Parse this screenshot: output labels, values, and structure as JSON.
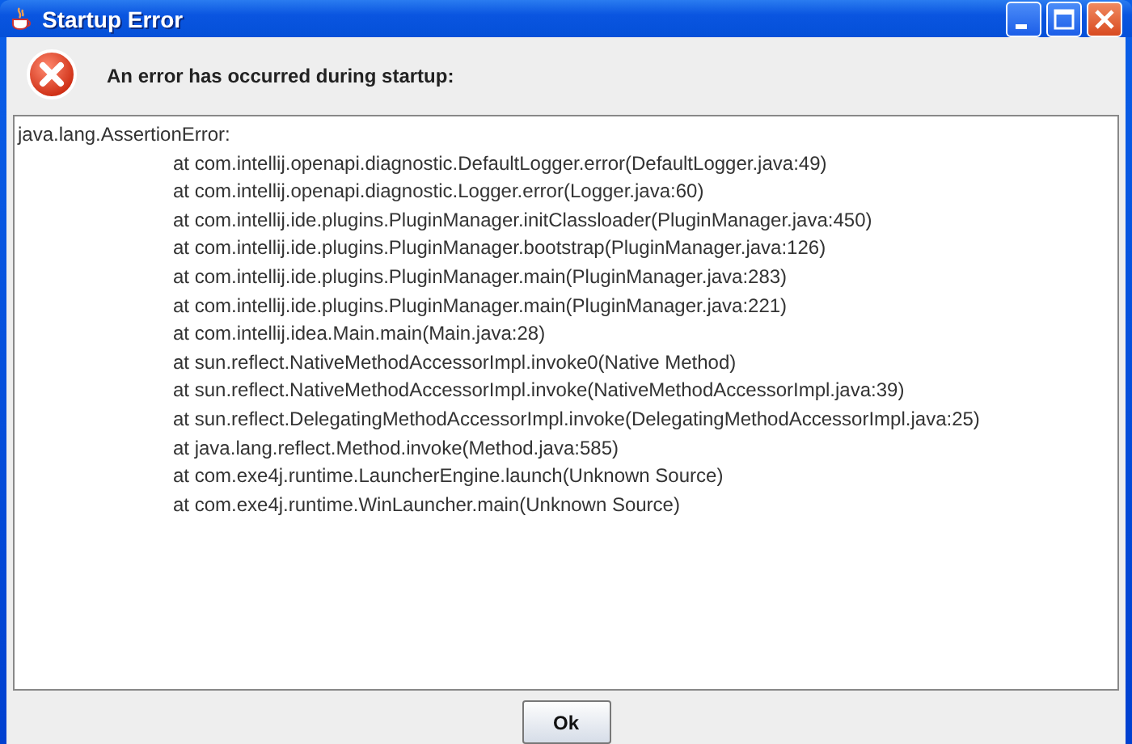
{
  "window": {
    "title": "Startup Error"
  },
  "message": "An error has occurred during startup:",
  "error": {
    "heading": "java.lang.AssertionError:",
    "stack": [
      "at com.intellij.openapi.diagnostic.DefaultLogger.error(DefaultLogger.java:49)",
      "at com.intellij.openapi.diagnostic.Logger.error(Logger.java:60)",
      "at com.intellij.ide.plugins.PluginManager.initClassloader(PluginManager.java:450)",
      "at com.intellij.ide.plugins.PluginManager.bootstrap(PluginManager.java:126)",
      "at com.intellij.ide.plugins.PluginManager.main(PluginManager.java:283)",
      "at com.intellij.ide.plugins.PluginManager.main(PluginManager.java:221)",
      "at com.intellij.idea.Main.main(Main.java:28)",
      "at sun.reflect.NativeMethodAccessorImpl.invoke0(Native Method)",
      "at sun.reflect.NativeMethodAccessorImpl.invoke(NativeMethodAccessorImpl.java:39)",
      "at sun.reflect.DelegatingMethodAccessorImpl.invoke(DelegatingMethodAccessorImpl.java:25)",
      "at java.lang.reflect.Method.invoke(Method.java:585)",
      "at com.exe4j.runtime.LauncherEngine.launch(Unknown Source)",
      "at com.exe4j.runtime.WinLauncher.main(Unknown Source)"
    ]
  },
  "buttons": [
    "Ok"
  ]
}
